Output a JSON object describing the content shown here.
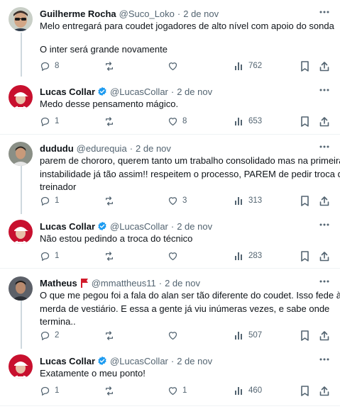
{
  "tweets": [
    {
      "name": "Guilherme Rocha",
      "verified": false,
      "handle": "@Suco_Loko",
      "dot": "·",
      "date": "2 de nov",
      "lines": [
        "Melo entregará para coudet jogadores de alto nível com apoio do sonda"
      ],
      "lines2": [
        "O inter será grande novamente"
      ],
      "reply_count": "8",
      "retweet_count": "",
      "like_count": "",
      "view_count": "762",
      "avatar": "sunglasses-avatar"
    },
    {
      "name": "Lucas Collar",
      "verified": true,
      "handle": "@LucasCollar",
      "dot": "·",
      "date": "2 de nov",
      "lines": [
        "Medo desse pensamento mágico."
      ],
      "reply_count": "1",
      "retweet_count": "",
      "like_count": "8",
      "view_count": "653",
      "avatar": "red-cap-avatar"
    },
    {
      "name": "dududu",
      "verified": false,
      "handle": "@edurequia",
      "dot": "·",
      "date": "2 de nov",
      "lines": [
        "parem de chororo, querem tanto um trabalho consolidado mas na primeira",
        "instabilidade já tão assim!! respeitem o processo, PAREM de pedir troca de",
        "treinador"
      ],
      "reply_count": "1",
      "retweet_count": "",
      "like_count": "3",
      "view_count": "313",
      "avatar": "man-avatar"
    },
    {
      "name": "Lucas Collar",
      "verified": true,
      "handle": "@LucasCollar",
      "dot": "·",
      "date": "2 de nov",
      "lines": [
        "Não estou pedindo a troca do técnico"
      ],
      "reply_count": "1",
      "retweet_count": "",
      "like_count": "",
      "view_count": "283",
      "avatar": "red-cap-avatar"
    },
    {
      "name": "Matheus",
      "verified": false,
      "handle": "@mmattheus11",
      "dot": "·",
      "date": "2 de nov",
      "lines": [
        "O que me pegou foi a fala do alan ser tão diferente do coudet. Isso fede à",
        "merda de vestiário. E essa a gente já viu inúmeras vezes, e sabe onde",
        "termina.."
      ],
      "reply_count": "2",
      "retweet_count": "",
      "like_count": "",
      "view_count": "507",
      "avatar": "man-dark-avatar"
    },
    {
      "name": "Lucas Collar",
      "verified": true,
      "handle": "@LucasCollar",
      "dot": "·",
      "date": "2 de nov",
      "lines": [
        "Exatamente o meu ponto!"
      ],
      "reply_count": "1",
      "retweet_count": "",
      "like_count": "1",
      "view_count": "460",
      "avatar": "red-cap-avatar"
    }
  ],
  "colors": {
    "verified": "#1d9bf0",
    "muted": "#536471",
    "text": "#0f1419",
    "thread_line": "#cfd9de",
    "flag_red": "#d11a2a"
  }
}
